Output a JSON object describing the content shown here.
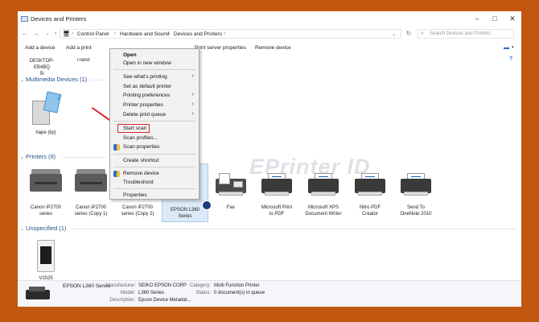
{
  "window": {
    "title": "Devices and Printers"
  },
  "nav": {
    "breadcrumb": [
      "Control Panel",
      "Hardware and Sound",
      "Devices and Printers"
    ],
    "search_placeholder": "Search Devices and Printers"
  },
  "toolbar": {
    "add_device": "Add a device",
    "add_printer": "Add a printer",
    "print_server": "Print server properties",
    "remove_device": "Remove device"
  },
  "top_devices": [
    {
      "label": "DESKTOP-EB4BQ\n5I"
    },
    {
      "label": "Transf"
    }
  ],
  "groups": {
    "multimedia": "Multimedia Devices (1)",
    "printers": "Printers (9)",
    "unspecified": "Unspecified (1)"
  },
  "multimedia_devices": [
    {
      "label": "hape (kp)"
    }
  ],
  "printers": [
    {
      "label": "Canon iP2700\nseries"
    },
    {
      "label": "Canon iP2700\nseries (Copy 1)"
    },
    {
      "label": "Canon iP2700\nseries (Copy 2)"
    },
    {
      "label": "EPSON L360\nSeries"
    },
    {
      "label": "Fax"
    },
    {
      "label": "Microsoft Print\nto PDF"
    },
    {
      "label": "Microsoft XPS\nDocument Writer"
    },
    {
      "label": "Nitro PDF\nCreator"
    },
    {
      "label": "Send To\nOneNote 2010"
    }
  ],
  "unspecified_devices": [
    {
      "label": "V2025"
    }
  ],
  "context_menu": {
    "open": "Open",
    "open_new_window": "Open in new window",
    "see_printing": "See what's printing",
    "set_default": "Set as default printer",
    "printing_prefs": "Printing preferences",
    "printer_props": "Printer properties",
    "delete_queue": "Delete print queue",
    "start_scan": "Start scan",
    "scan_profiles": "Scan profiles...",
    "scan_properties": "Scan properties",
    "create_shortcut": "Create shortcut",
    "remove_device": "Remove device",
    "troubleshoot": "Troubleshoot",
    "properties": "Properties"
  },
  "details": {
    "name": "EPSON L360 Series",
    "manufacturer_label": "Manufacturer:",
    "manufacturer": "SEIKO EPSON CORP",
    "model_label": "Model:",
    "model": "L360 Series",
    "description_label": "Description:",
    "description": "Epson Device Metadat...",
    "category_label": "Category:",
    "category": "Multi Function Printer",
    "status_label": "Status:",
    "status": "0 document(s) in queue"
  },
  "watermark": "EPrinter ID"
}
